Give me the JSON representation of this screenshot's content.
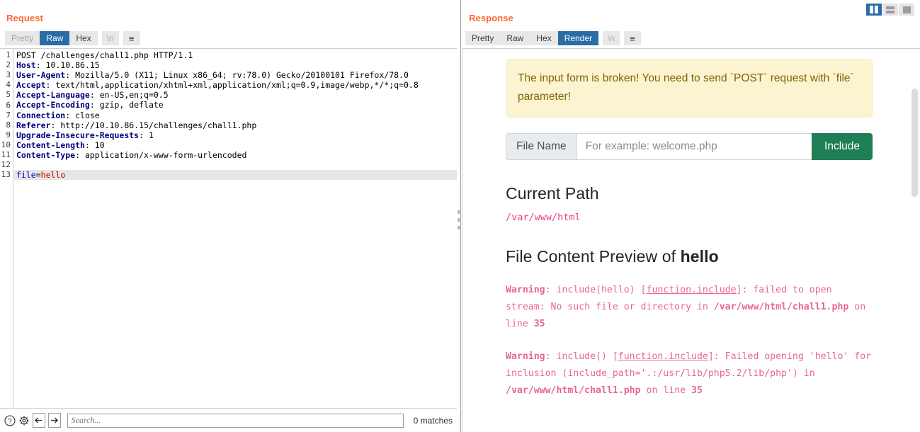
{
  "request": {
    "title": "Request",
    "tabs": [
      {
        "label": "Pretty",
        "state": "dim"
      },
      {
        "label": "Raw",
        "state": "active"
      },
      {
        "label": "Hex",
        "state": "normal"
      }
    ],
    "newline_label": "\\n",
    "menu_icon": "hamburger-icon",
    "lines": [
      {
        "n": "1",
        "parts": [
          {
            "t": "POST /challenges/chall1.php HTTP/1.1",
            "c": "hv"
          }
        ]
      },
      {
        "n": "2",
        "parts": [
          {
            "t": "Host",
            "c": "hk"
          },
          {
            "t": ": 10.10.86.15",
            "c": "hv"
          }
        ]
      },
      {
        "n": "3",
        "parts": [
          {
            "t": "User-Agent",
            "c": "hk"
          },
          {
            "t": ": Mozilla/5.0 (X11; Linux x86_64; rv:78.0) Gecko/20100101 Firefox/78.0",
            "c": "hv"
          }
        ]
      },
      {
        "n": "4",
        "parts": [
          {
            "t": "Accept",
            "c": "hk"
          },
          {
            "t": ": text/html,application/xhtml+xml,application/xml;q=0.9,image/webp,*/*;q=0.8",
            "c": "hv"
          }
        ]
      },
      {
        "n": "5",
        "parts": [
          {
            "t": "Accept-Language",
            "c": "hk"
          },
          {
            "t": ": en-US,en;q=0.5",
            "c": "hv"
          }
        ]
      },
      {
        "n": "6",
        "parts": [
          {
            "t": "Accept-Encoding",
            "c": "hk"
          },
          {
            "t": ": gzip, deflate",
            "c": "hv"
          }
        ]
      },
      {
        "n": "7",
        "parts": [
          {
            "t": "Connection",
            "c": "hk"
          },
          {
            "t": ": close",
            "c": "hv"
          }
        ]
      },
      {
        "n": "8",
        "parts": [
          {
            "t": "Referer",
            "c": "hk"
          },
          {
            "t": ": http://10.10.86.15/challenges/chall1.php",
            "c": "hv"
          }
        ]
      },
      {
        "n": "9",
        "parts": [
          {
            "t": "Upgrade-Insecure-Requests",
            "c": "hk"
          },
          {
            "t": ": 1",
            "c": "hv"
          }
        ]
      },
      {
        "n": "10",
        "parts": [
          {
            "t": "Content-Length",
            "c": "hk"
          },
          {
            "t": ": 10",
            "c": "hv"
          }
        ]
      },
      {
        "n": "11",
        "parts": [
          {
            "t": "Content-Type",
            "c": "hk"
          },
          {
            "t": ": application/x-www-form-urlencoded",
            "c": "hv"
          }
        ]
      },
      {
        "n": "12",
        "parts": [
          {
            "t": "",
            "c": "hv"
          }
        ]
      },
      {
        "n": "13",
        "highlight": true,
        "parts": [
          {
            "t": "file",
            "c": "pk"
          },
          {
            "t": "=",
            "c": "hv"
          },
          {
            "t": "hello",
            "c": "pv"
          }
        ]
      }
    ],
    "bottombar": {
      "help_icon": "help-icon",
      "settings_icon": "gear-icon",
      "prev_icon": "arrow-left-icon",
      "next_icon": "arrow-right-icon",
      "search_placeholder": "Search...",
      "search_value": "",
      "matches_label": "0 matches"
    }
  },
  "response": {
    "title": "Response",
    "tabs": [
      {
        "label": "Pretty",
        "state": "normal"
      },
      {
        "label": "Raw",
        "state": "normal"
      },
      {
        "label": "Hex",
        "state": "normal"
      },
      {
        "label": "Render",
        "state": "active"
      }
    ],
    "newline_label": "\\n",
    "menu_icon": "hamburger-icon",
    "rendered": {
      "alert_text": "The input form is broken! You need to send `POST` request with `file` parameter!",
      "form": {
        "label": "File Name",
        "input_value": "",
        "input_placeholder": "For example: welcome.php",
        "submit_label": "Include"
      },
      "current_path_heading": "Current Path",
      "current_path_value": "/var/www/html",
      "preview_heading_prefix": "File Content Preview of ",
      "preview_heading_file": "hello",
      "warnings": [
        {
          "label": "Warning",
          "segments": [
            {
              "t": ": include(hello) [",
              "style": "plain"
            },
            {
              "t": "function.include",
              "style": "link"
            },
            {
              "t": "]: failed to open stream: No such file or directory in ",
              "style": "plain"
            },
            {
              "t": "/var/www/html/chall1.php",
              "style": "bold"
            },
            {
              "t": " on line ",
              "style": "plain"
            },
            {
              "t": "35",
              "style": "bold"
            }
          ]
        },
        {
          "label": "Warning",
          "segments": [
            {
              "t": ": include() [",
              "style": "plain"
            },
            {
              "t": "function.include",
              "style": "link"
            },
            {
              "t": "]: Failed opening 'hello' for inclusion (include_path='.:/usr/lib/php5.2/lib/php') in ",
              "style": "plain"
            },
            {
              "t": "/var/www/html/chall1.php",
              "style": "bold"
            },
            {
              "t": " on line ",
              "style": "plain"
            },
            {
              "t": "35",
              "style": "bold"
            }
          ]
        }
      ]
    }
  },
  "layout_toggles": [
    {
      "name": "split-vertical",
      "state": "active"
    },
    {
      "name": "split-horizontal",
      "state": "normal"
    },
    {
      "name": "single-pane",
      "state": "normal"
    }
  ],
  "colors": {
    "panel_title": "#ff6633",
    "tab_active_bg": "#2a6ca8",
    "alert_bg": "#fcf3d0",
    "alert_text": "#7d6608",
    "include_btn": "#1e7e54",
    "php_warning": "#e8659b",
    "mono_path": "#e83e8c"
  }
}
